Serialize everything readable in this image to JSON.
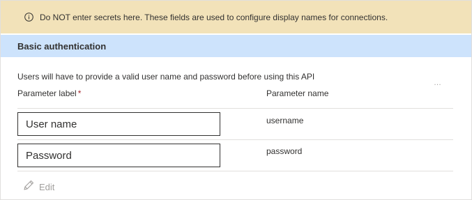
{
  "warning": {
    "icon": "info-icon",
    "text": "Do NOT enter secrets here. These fields are used to configure display names for connections."
  },
  "section": {
    "title": "Basic authentication",
    "description": "Users will have to provide a valid user name and password before using this API"
  },
  "columns": {
    "label_header": "Parameter label",
    "required_marker": "*",
    "name_header": "Parameter name"
  },
  "rows": [
    {
      "label_value": "User name",
      "param_name": "username"
    },
    {
      "label_value": "Password",
      "param_name": "password"
    }
  ],
  "actions": {
    "edit_label": "Edit",
    "edit_icon": "pencil-icon",
    "more_icon": "more-options-icon"
  },
  "colors": {
    "warning_bg": "#f2e2b9",
    "section_bg": "#cde3fc",
    "required": "#a4262c",
    "disabled_text": "#a19f9d"
  }
}
